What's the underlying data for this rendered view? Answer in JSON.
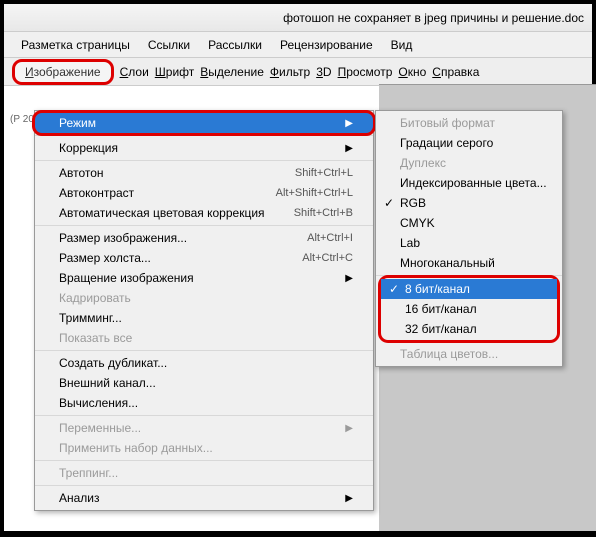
{
  "title": "фотошоп не сохраняет в jpeg причины и решение.doc",
  "menubar": [
    "Разметка страницы",
    "Ссылки",
    "Рассылки",
    "Рецензирование",
    "Вид"
  ],
  "toolbar": {
    "image_btn": "Изображение",
    "items": [
      "Слои",
      "Шрифт",
      "Выделение",
      "Фильтр",
      "3D",
      "Просмотр",
      "Окно",
      "Справка"
    ]
  },
  "dropdown": {
    "mode": {
      "label": "Режим"
    },
    "correction": {
      "label": "Коррекция"
    },
    "auto": [
      {
        "label": "Автотон",
        "sc": "Shift+Ctrl+L"
      },
      {
        "label": "Автоконтраст",
        "sc": "Alt+Shift+Ctrl+L"
      },
      {
        "label": "Автоматическая цветовая коррекция",
        "sc": "Shift+Ctrl+B"
      }
    ],
    "size": [
      {
        "label": "Размер изображения...",
        "sc": "Alt+Ctrl+I"
      },
      {
        "label": "Размер холста...",
        "sc": "Alt+Ctrl+C"
      },
      {
        "label": "Вращение изображения"
      },
      {
        "label": "Кадрировать",
        "disabled": true
      },
      {
        "label": "Тримминг..."
      },
      {
        "label": "Показать все",
        "disabled": true
      }
    ],
    "dup": [
      {
        "label": "Создать дубликат..."
      },
      {
        "label": "Внешний канал..."
      },
      {
        "label": "Вычисления..."
      }
    ],
    "vars": [
      {
        "label": "Переменные...",
        "disabled": true
      },
      {
        "label": "Применить набор данных...",
        "disabled": true
      }
    ],
    "trap": {
      "label": "Треппинг...",
      "disabled": true
    },
    "analysis": {
      "label": "Анализ"
    }
  },
  "submenu": {
    "modes": [
      {
        "label": "Битовый формат",
        "disabled": true
      },
      {
        "label": "Градации серого"
      },
      {
        "label": "Дуплекс",
        "disabled": true
      },
      {
        "label": "Индексированные цвета..."
      },
      {
        "label": "RGB",
        "checked": true
      },
      {
        "label": "CMYK"
      },
      {
        "label": "Lab"
      },
      {
        "label": "Многоканальный"
      }
    ],
    "bits": [
      {
        "label": "8 бит/канал",
        "checked": true,
        "hi": true
      },
      {
        "label": "16 бит/канал"
      },
      {
        "label": "32 бит/канал"
      }
    ],
    "colortable": {
      "label": "Таблица цветов...",
      "disabled": true
    }
  },
  "side": "(Р\n20"
}
